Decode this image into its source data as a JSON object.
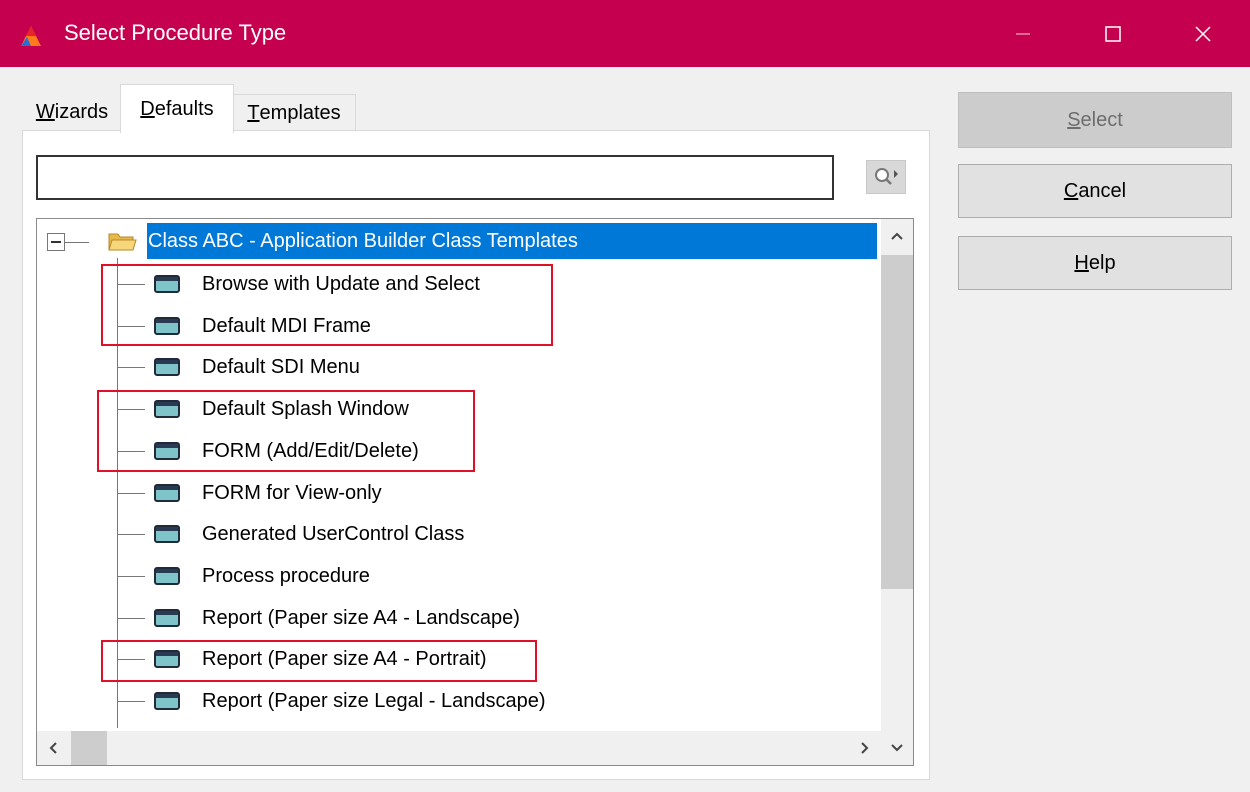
{
  "window": {
    "title": "Select Procedure Type"
  },
  "tabs": [
    {
      "first": "W",
      "rest": "izards",
      "active": false
    },
    {
      "first": "D",
      "rest": "efaults",
      "active": true
    },
    {
      "first": "T",
      "rest": "emplates",
      "active": false
    }
  ],
  "search": {
    "value": "",
    "placeholder": ""
  },
  "tree": {
    "root_label": "Class ABC - Application Builder Class Templates",
    "items": [
      {
        "label": "Browse with Update and Select"
      },
      {
        "label": "Default MDI Frame"
      },
      {
        "label": "Default SDI Menu"
      },
      {
        "label": "Default Splash Window"
      },
      {
        "label": "FORM (Add/Edit/Delete)"
      },
      {
        "label": "FORM for View-only"
      },
      {
        "label": "Generated UserControl Class"
      },
      {
        "label": "Process procedure"
      },
      {
        "label": "Report (Paper size A4 - Landscape)"
      },
      {
        "label": "Report (Paper size A4 - Portrait)"
      },
      {
        "label": "Report (Paper size Legal - Landscape)"
      }
    ],
    "highlighted_groups": [
      [
        "Browse with Update and Select",
        "Default MDI Frame"
      ],
      [
        "Default Splash Window",
        "FORM (Add/Edit/Delete)"
      ],
      [
        "Report (Paper size A4 - Portrait)"
      ]
    ]
  },
  "buttons": {
    "select": {
      "first": "S",
      "rest": "elect",
      "enabled": false
    },
    "cancel": {
      "first": "C",
      "rest": "ancel",
      "enabled": true
    },
    "help": {
      "first": "H",
      "rest": "elp",
      "enabled": true
    }
  },
  "colors": {
    "titlebar": "#c4004f",
    "selection": "#0078d7",
    "highlight_box": "#e0102a"
  },
  "icons": [
    "app-icon",
    "minimize-icon",
    "maximize-icon",
    "close-icon",
    "locate-icon",
    "folder-open-icon",
    "procedure-icon"
  ]
}
